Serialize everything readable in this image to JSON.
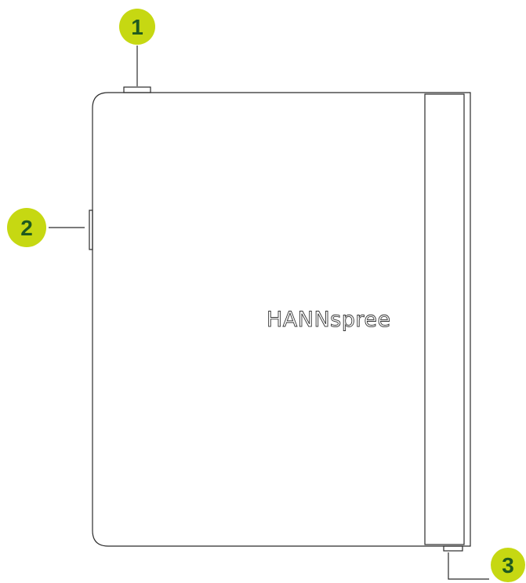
{
  "device": {
    "brand_logo": "HANNspree"
  },
  "callouts": [
    {
      "id": "callout-1",
      "label": "1"
    },
    {
      "id": "callout-2",
      "label": "2"
    },
    {
      "id": "callout-3",
      "label": "3"
    }
  ],
  "colors": {
    "badge_fill": "#c6d812",
    "badge_text": "#1f5a1f",
    "outline": "#2b2b2b"
  }
}
